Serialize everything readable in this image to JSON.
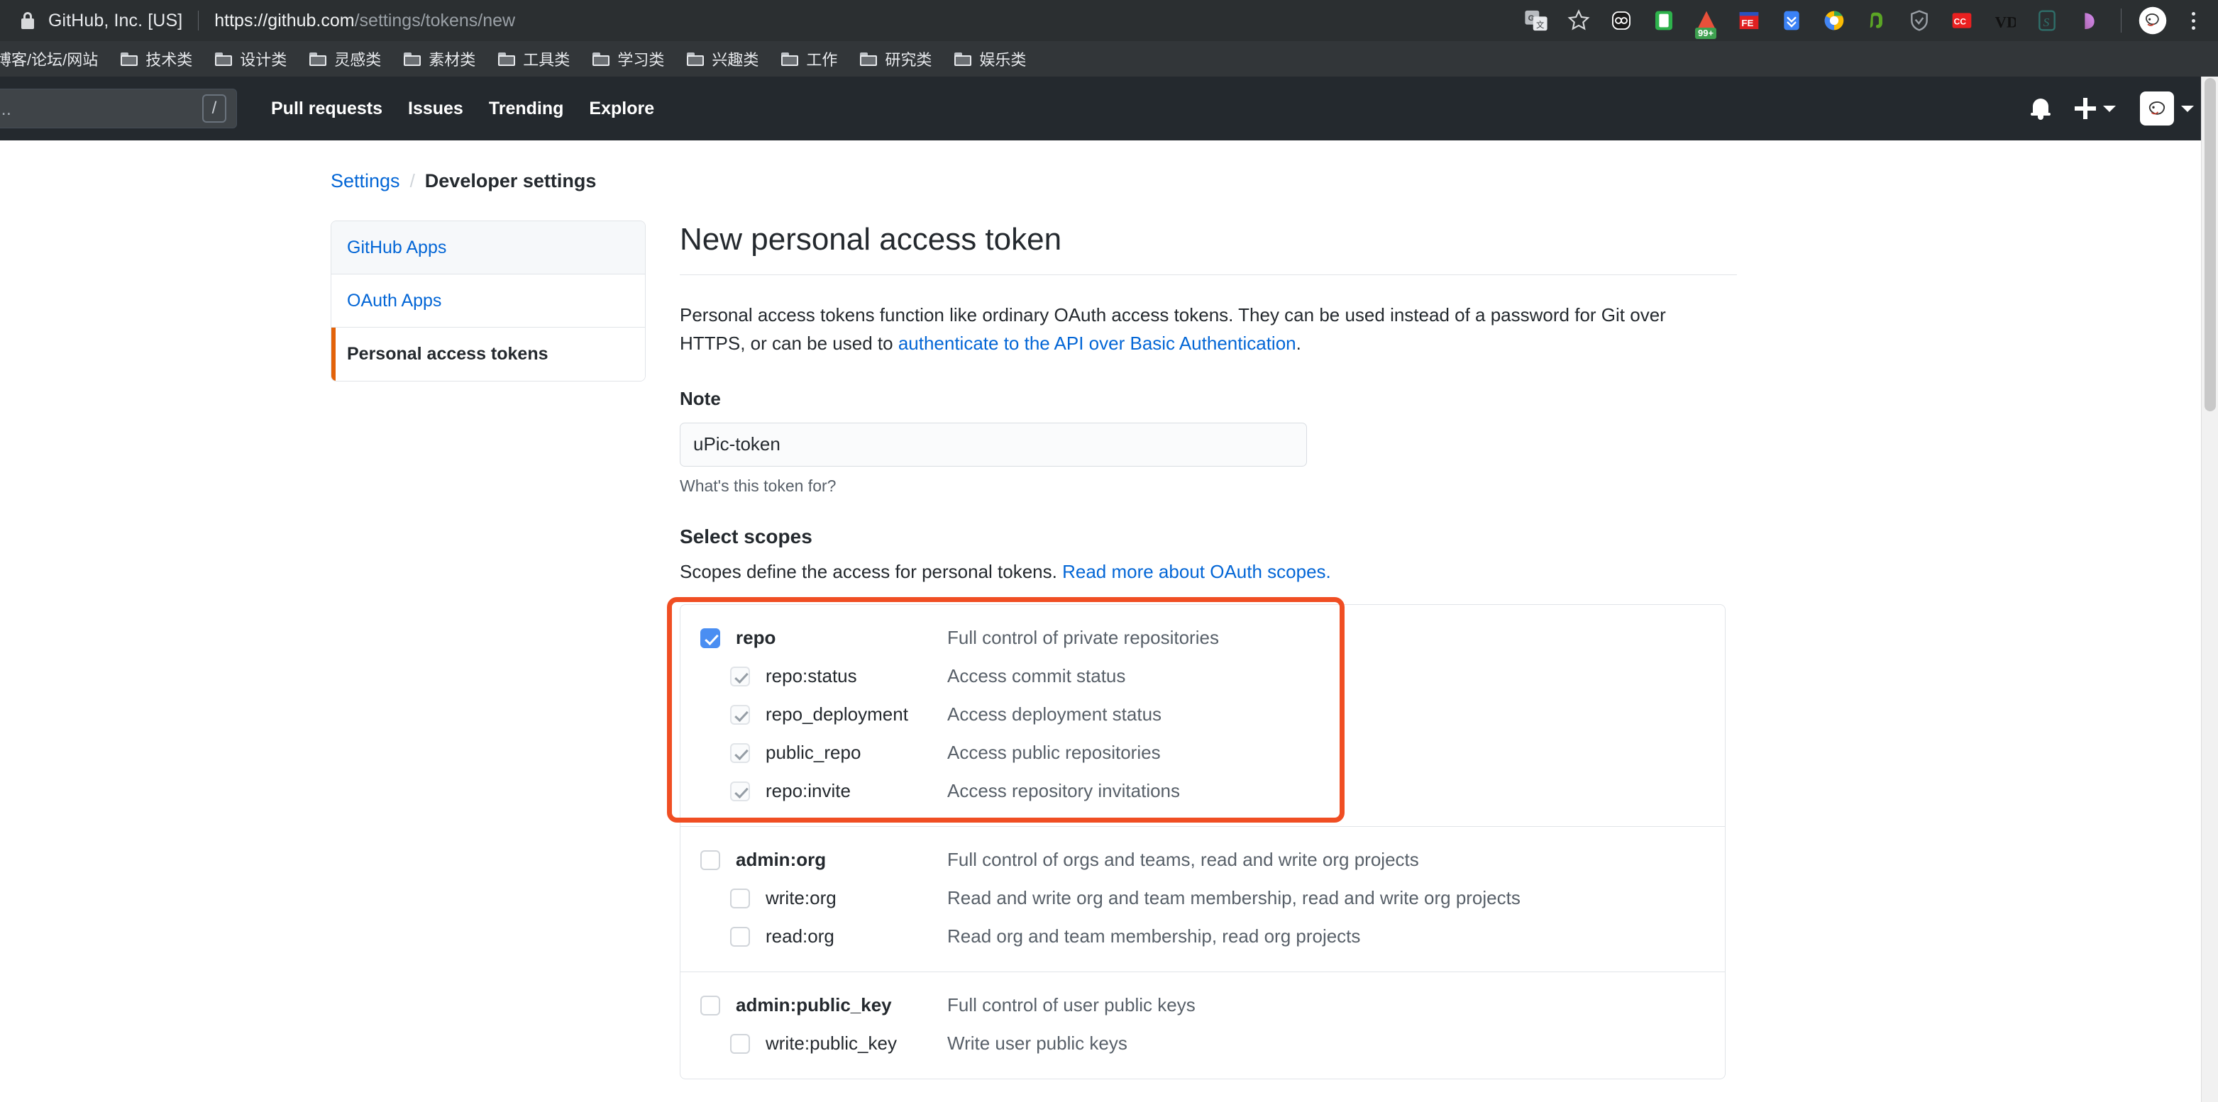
{
  "browser": {
    "security_label": "GitHub, Inc. [US]",
    "url_origin": "https://github.com",
    "url_path": "/settings/tokens/new",
    "lock_icon": "lock-icon",
    "extensions": [
      {
        "name": "google-translate-icon",
        "glyph": "G⁠文"
      },
      {
        "name": "bookmark-star-icon",
        "glyph": "☆"
      },
      {
        "name": "pocket-icon",
        "glyph": "oo"
      },
      {
        "name": "green-phone-icon",
        "glyph": "▯"
      },
      {
        "name": "feedly-icon",
        "glyph": "▲",
        "badge": "99+"
      },
      {
        "name": "fe-extension-icon",
        "glyph": "FE"
      },
      {
        "name": "download-chevrons-icon",
        "glyph": "⌄"
      },
      {
        "name": "colorpick-icon",
        "glyph": "◕"
      },
      {
        "name": "evernote-icon",
        "glyph": "🐘"
      },
      {
        "name": "shield-extension-icon",
        "glyph": "⛉"
      },
      {
        "name": "cc-subtitles-icon",
        "glyph": "CC"
      },
      {
        "name": "vd-downloader-icon",
        "glyph": "VD"
      },
      {
        "name": "s-extension-icon",
        "glyph": "S"
      },
      {
        "name": "gradient-extension-icon",
        "glyph": "◢"
      }
    ],
    "profile_icon": "profile-avatar-icon",
    "menu_icon": "chrome-menu-icon",
    "bookmarks": [
      {
        "label": "博客/论坛/网站",
        "has_folder": false
      },
      {
        "label": "技术类",
        "has_folder": true
      },
      {
        "label": "设计类",
        "has_folder": true
      },
      {
        "label": "灵感类",
        "has_folder": true
      },
      {
        "label": "素材类",
        "has_folder": true
      },
      {
        "label": "工具类",
        "has_folder": true
      },
      {
        "label": "学习类",
        "has_folder": true
      },
      {
        "label": "兴趣类",
        "has_folder": true
      },
      {
        "label": "工作",
        "has_folder": true
      },
      {
        "label": "研究类",
        "has_folder": true
      },
      {
        "label": "娱乐类",
        "has_folder": true
      }
    ]
  },
  "gh_header": {
    "search_placeholder": "h or jump to...",
    "search_shortcut": "/",
    "nav": [
      {
        "label": "Pull requests"
      },
      {
        "label": "Issues"
      },
      {
        "label": "Trending"
      },
      {
        "label": "Explore"
      }
    ],
    "notifications_icon": "bell-icon",
    "create_new_icon": "plus-icon",
    "create_new_caret": "chevron-down-icon",
    "avatar": "user-avatar",
    "avatar_caret": "chevron-down-icon"
  },
  "breadcrumb": {
    "settings": "Settings",
    "separator": "/",
    "current": "Developer settings"
  },
  "sidebar": {
    "items": [
      {
        "label": "GitHub Apps",
        "state": "link",
        "name": "sidebar-item-github-apps"
      },
      {
        "label": "OAuth Apps",
        "state": "link",
        "name": "sidebar-item-oauth-apps"
      },
      {
        "label": "Personal access tokens",
        "state": "active",
        "name": "sidebar-item-personal-access-tokens"
      }
    ]
  },
  "main": {
    "title": "New personal access token",
    "intro_part1": "Personal access tokens function like ordinary OAuth access tokens. They can be used instead of a password for Git over HTTPS, or can be used to ",
    "intro_link": "authenticate to the API over Basic Authentication",
    "intro_part2": ".",
    "note_label": "Note",
    "note_value": "uPic-token",
    "note_hint": "What's this token for?",
    "scopes_title": "Select scopes",
    "scopes_sub_text": "Scopes define the access for personal tokens. ",
    "scopes_sub_link": "Read more about OAuth scopes.",
    "highlight_color": "#f04e23",
    "accent_color": "#0366d6",
    "active_marker_color": "#e36209",
    "checkbox_checked_color": "#4a8ef2"
  },
  "scopes": [
    {
      "group": "repo",
      "rows": [
        {
          "name": "repo",
          "desc": "Full control of private repositories",
          "level": "parent",
          "checkbox": "checked"
        },
        {
          "name": "repo:status",
          "desc": "Access commit status",
          "level": "child",
          "checkbox": "disabled-checked"
        },
        {
          "name": "repo_deployment",
          "desc": "Access deployment status",
          "level": "child",
          "checkbox": "disabled-checked"
        },
        {
          "name": "public_repo",
          "desc": "Access public repositories",
          "level": "child",
          "checkbox": "disabled-checked"
        },
        {
          "name": "repo:invite",
          "desc": "Access repository invitations",
          "level": "child",
          "checkbox": "disabled-checked"
        }
      ]
    },
    {
      "group": "admin:org",
      "rows": [
        {
          "name": "admin:org",
          "desc": "Full control of orgs and teams, read and write org projects",
          "level": "parent",
          "checkbox": "unchecked"
        },
        {
          "name": "write:org",
          "desc": "Read and write org and team membership, read and write org projects",
          "level": "child",
          "checkbox": "unchecked"
        },
        {
          "name": "read:org",
          "desc": "Read org and team membership, read org projects",
          "level": "child",
          "checkbox": "unchecked"
        }
      ]
    },
    {
      "group": "admin:public_key",
      "rows": [
        {
          "name": "admin:public_key",
          "desc": "Full control of user public keys",
          "level": "parent",
          "checkbox": "unchecked"
        },
        {
          "name": "write:public_key",
          "desc": "Write user public keys",
          "level": "child",
          "checkbox": "unchecked"
        }
      ]
    }
  ]
}
